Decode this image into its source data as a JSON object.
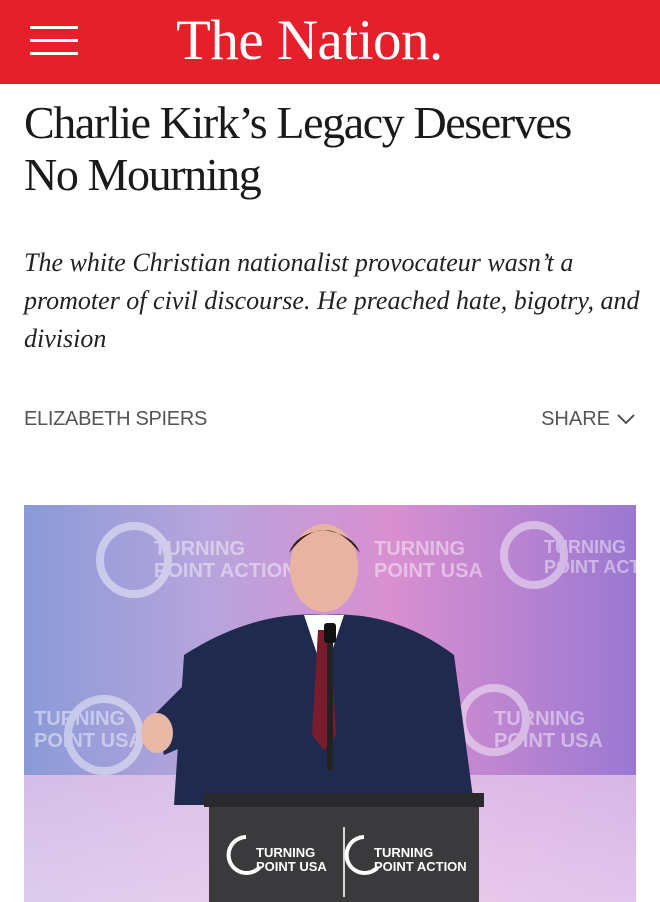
{
  "header": {
    "logo_text": "The Nation.",
    "menu_icon": "hamburger-menu-icon",
    "background_color": "#e5202a"
  },
  "article": {
    "headline": "Charlie Kirk’s Legacy Deserves No Mourning",
    "dek": "The white Christian nationalist provocateur wasn’t a promoter of civil discourse. He preached hate, bigotry, and division",
    "author": "ELIZABETH SPIERS",
    "share_label": "SHARE",
    "share_icon": "chevron-down-icon"
  },
  "hero_image": {
    "podium_sign_left_line1": "TURNING",
    "podium_sign_left_line2": "POINT USA",
    "podium_sign_right_line1": "TURNING",
    "podium_sign_right_line2": "POINT ACTION",
    "backdrop_text": [
      "TURNING",
      "POINT USA",
      "TURNING",
      "POINT ACTION"
    ]
  }
}
